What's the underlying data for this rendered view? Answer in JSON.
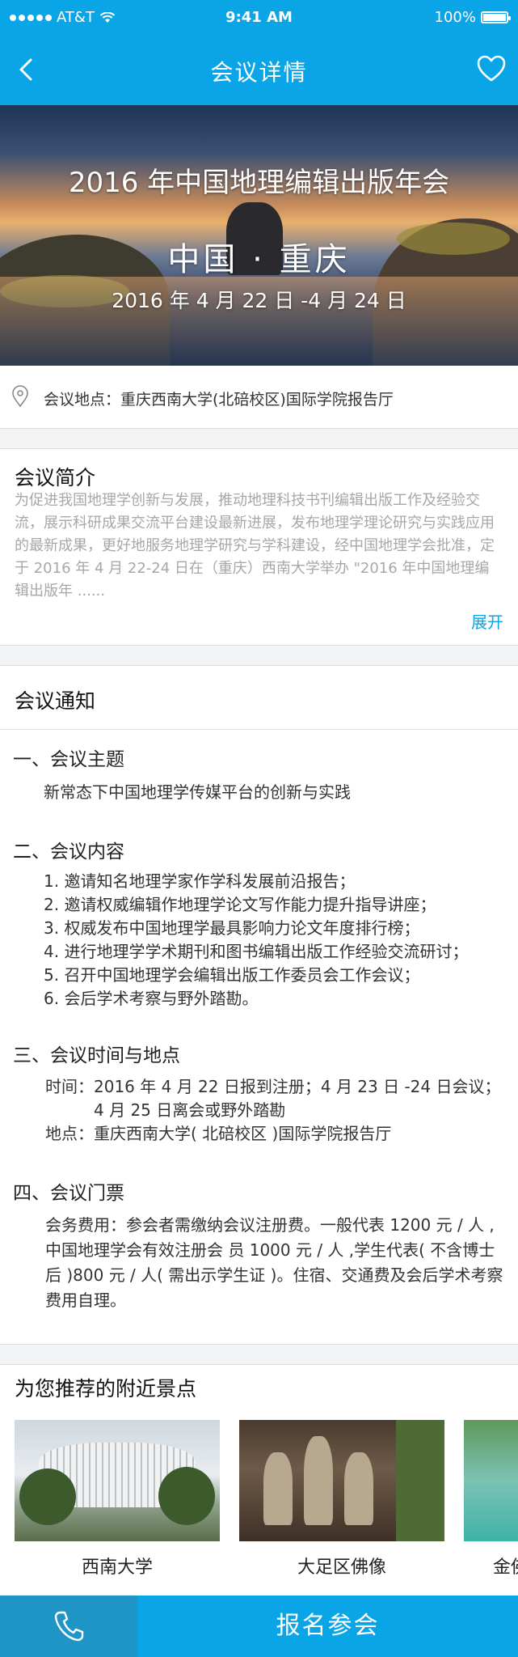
{
  "status_bar": {
    "carrier": "AT&T",
    "time": "9:41 AM",
    "battery": "100%"
  },
  "nav": {
    "title": "会议详情",
    "back_icon": "chevron-left-icon",
    "favorite_icon": "heart-icon"
  },
  "banner": {
    "title": "2016 年中国地理编辑出版年会",
    "location": "中国 · 重庆",
    "dates": "2016 年 4 月 22 日 -4 月 24 日"
  },
  "venue": {
    "label": "会议地点：重庆西南大学(北碚校区)国际学院报告厅"
  },
  "intro": {
    "heading": "会议简介",
    "text": "为促进我国地理学创新与发展，推动地理科技书刊编辑出版工作及经验交流，展示科研成果交流平台建设最新进展，发布地理学理论研究与实践应用的最新成果，更好地服务地理学研究与学科建设，经中国地理学会批准，定于 2016 年 4 月 22-24 日在（重庆）西南大学举办 \"2016 年中国地理编辑出版年 ......",
    "more_label": "展开"
  },
  "notice": {
    "heading": "会议通知",
    "sections": [
      {
        "title": "一、会议主题",
        "lines": [
          "新常态下中国地理学传媒平台的创新与实践"
        ]
      },
      {
        "title": "二、会议内容",
        "lines": [
          "1. 邀请知名地理学家作学科发展前沿报告；",
          "2. 邀请权威编辑作地理学论文写作能力提升指导讲座；",
          "3. 权威发布中国地理学最具影响力论文年度排行榜；",
          "4. 进行地理学学术期刊和图书编辑出版工作经验交流研讨；",
          "5. 召开中国地理学会编辑出版工作委员会工作会议；",
          "6. 会后学术考察与野外踏勘。"
        ]
      },
      {
        "title": "三、会议时间与地点",
        "time_key": "时间：",
        "time_value": "2016 年 4 月 22 日报到注册；4 月 23 日 -24 日会议；4 月 25 日离会或野外踏勘",
        "place_key": "地点：",
        "place_value": "重庆西南大学( 北碚校区 )国际学院报告厅"
      },
      {
        "title": "四、会议门票",
        "text": "会务费用：参会者需缴纳会议注册费。一般代表 1200 元 / 人 ,中国地理学会有效注册会 员 1000 元 / 人 ,学生代表( 不含博士后 )800 元 / 人( 需出示学生证 )。住宿、交通费及会后学术考察费用自理。"
      }
    ]
  },
  "nearby": {
    "heading": "为您推荐的附近景点",
    "items": [
      {
        "name": "西南大学"
      },
      {
        "name": "大足区佛像"
      },
      {
        "name": "金佛"
      }
    ]
  },
  "bottom_bar": {
    "call_icon": "phone-icon",
    "join_label": "报名参会"
  },
  "colors": {
    "primary": "#0aa5e6",
    "call_bg": "#1f95c7",
    "link": "#0aa5e6",
    "muted_text": "#a7a7a7"
  }
}
